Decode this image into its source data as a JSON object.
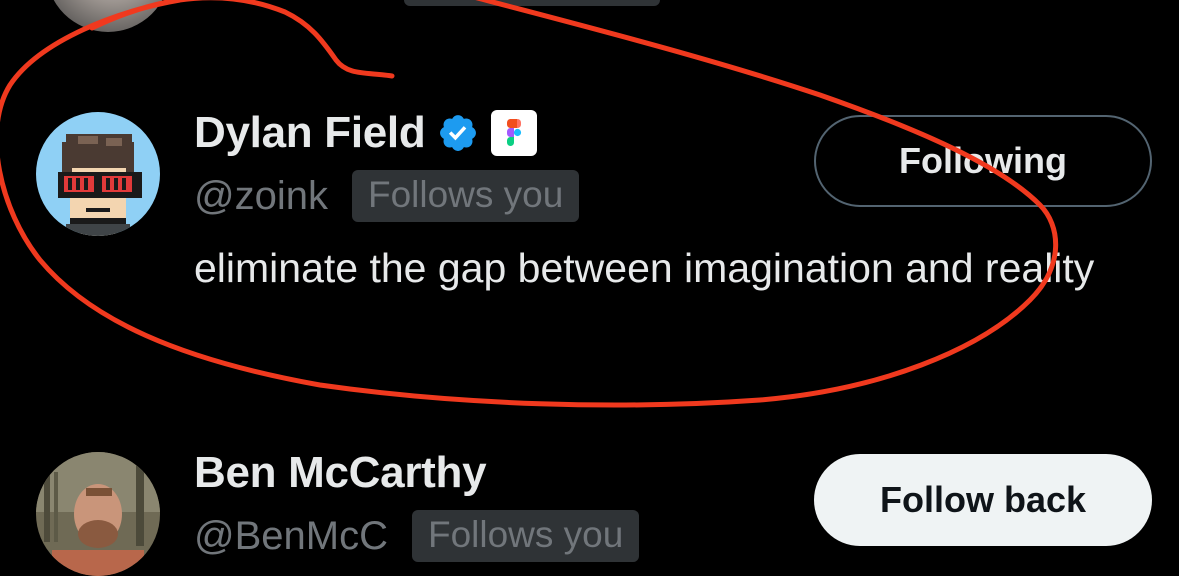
{
  "users": [
    {
      "display_name": "Dylan Field",
      "verified": true,
      "affiliation_icon": "figma-icon",
      "handle": "@zoink",
      "follows_you_label": "Follows you",
      "bio": "eliminate the gap between imagination and reality",
      "button_label": "Following",
      "button_state": "following"
    },
    {
      "display_name": "Ben McCarthy",
      "verified": false,
      "handle": "@BenMcC",
      "follows_you_label": "Follows you",
      "button_label": "Follow back",
      "button_state": "not-following"
    }
  ],
  "colors": {
    "background": "#000000",
    "primary_text": "#e7e9ea",
    "secondary_text": "#71767b",
    "badge_bg": "#2f3336",
    "verified_blue": "#1d9bf0",
    "annotation_red": "#f0391e",
    "follow_back_bg": "#eff3f4"
  }
}
